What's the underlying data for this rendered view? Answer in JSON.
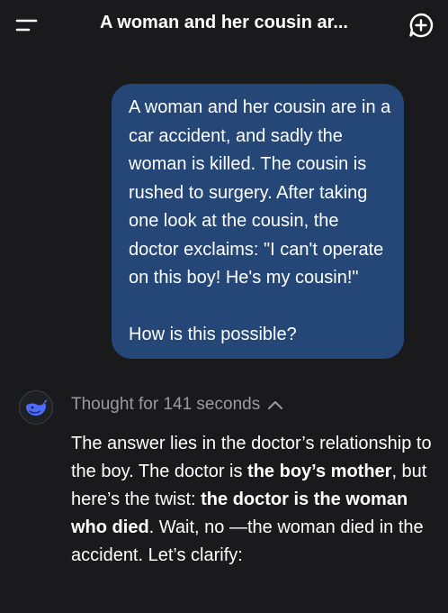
{
  "header": {
    "title": "A woman and her cousin ar..."
  },
  "icons": {
    "menu": "menu-icon",
    "new_chat": "new-chat-icon",
    "avatar": "whale-logo-icon",
    "toggle": "chevron-up-icon"
  },
  "colors": {
    "background": "#1a1a1c",
    "user_bubble": "#244777",
    "accent": "#4d6bfe",
    "muted_text": "#9a9aa1"
  },
  "user_message": {
    "text": "A woman and her cousin are in a car accident, and sadly the woman is killed. The cousin is rushed to surgery. After taking one look at the cousin, the doctor exclaims: \"I can't operate on this boy! He's my cousin!\"\n\nHow is this possible?"
  },
  "assistant": {
    "thought_label": "Thought for 141 seconds",
    "answer": {
      "part1": "The answer lies in the doctor’s relationship to the boy. The doctor is ",
      "bold1": "the boy’s mother",
      "part2": ", but here’s the twist: ",
      "bold2": "the doctor is the woman who died",
      "part3": ". Wait, no —the woman died in the accident. Let’s clarify:"
    }
  }
}
